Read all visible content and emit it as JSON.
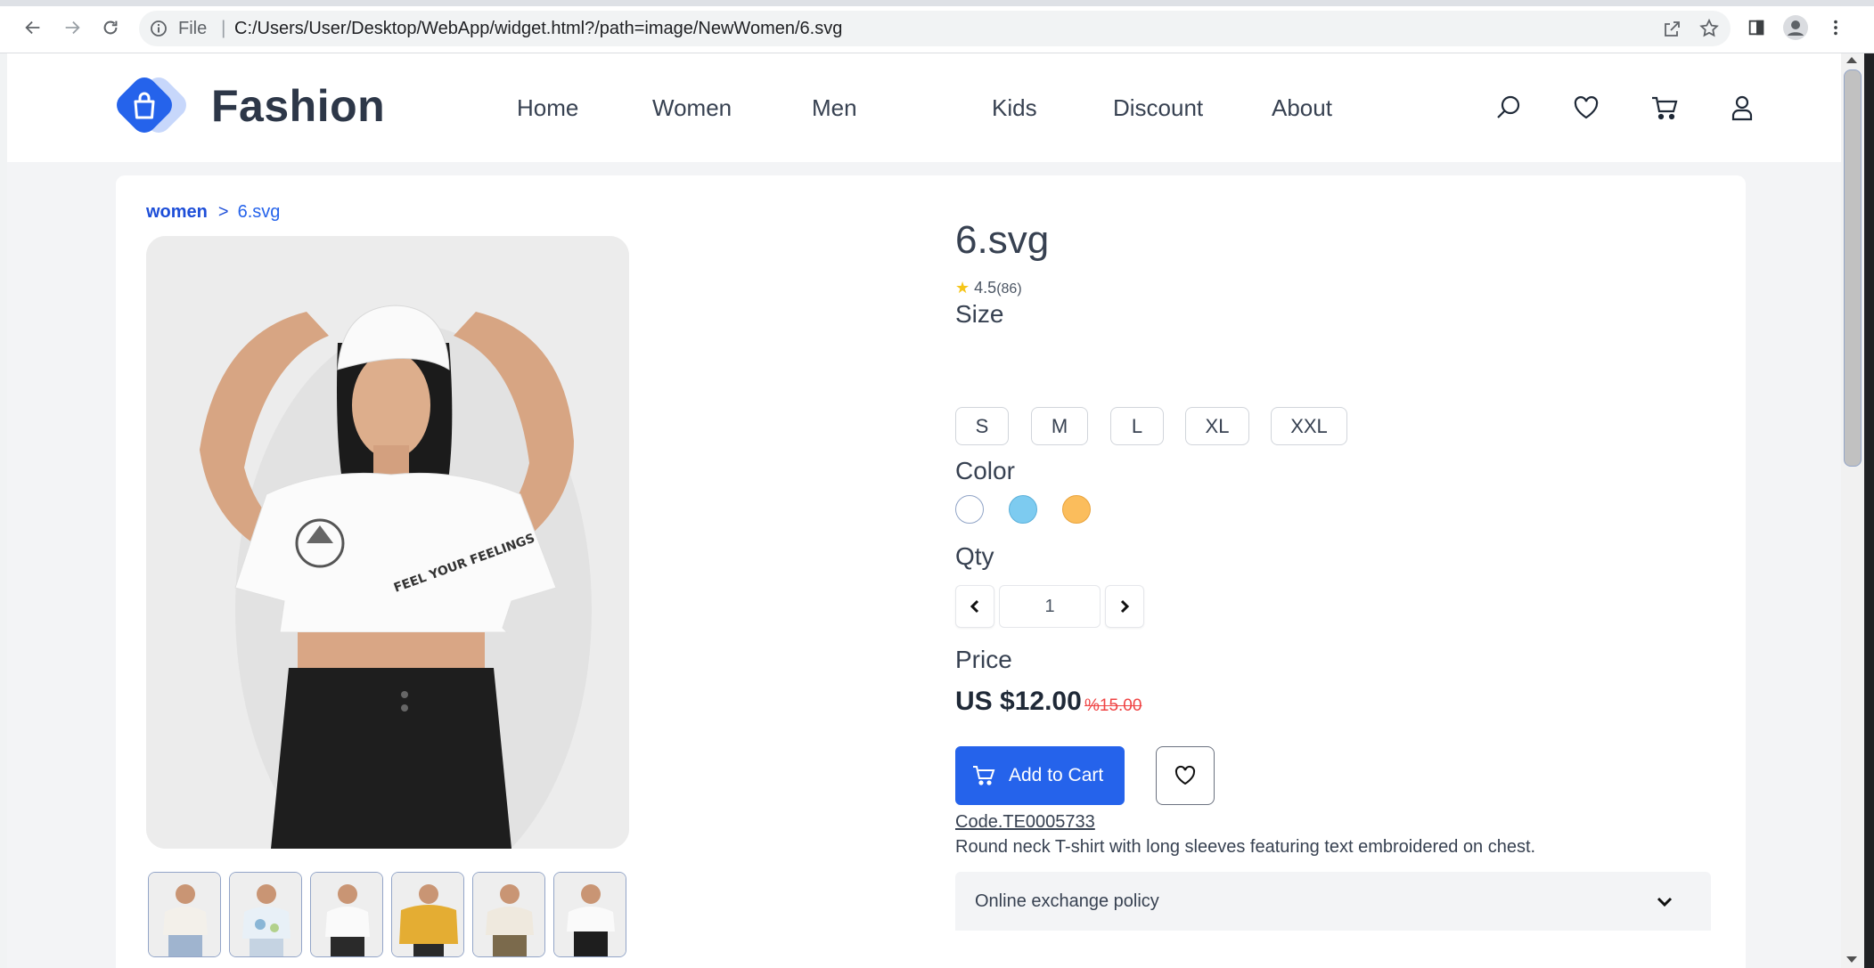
{
  "browser": {
    "file_label": "File",
    "separator": "|",
    "url": "C:/Users/User/Desktop/WebApp/widget.html?/path=image/NewWomen/6.svg"
  },
  "site": {
    "brand": "Fashion",
    "brand_color": "#2563eb",
    "nav": [
      "Home",
      "Women",
      "Men",
      "Kids",
      "Discount",
      "About"
    ],
    "header_icons": [
      "search-icon",
      "heart-icon",
      "cart-icon",
      "user-icon"
    ]
  },
  "breadcrumb": {
    "root": "women",
    "separator": ">",
    "current": "6.svg"
  },
  "product": {
    "title": "6.svg",
    "rating": "4.5",
    "rating_count": "(86)",
    "size_label": "Size",
    "sizes": [
      "S",
      "M",
      "L",
      "XL",
      "XXL"
    ],
    "color_label": "Color",
    "colors": [
      "#ffffff",
      "#7dcbf0",
      "#fbbd5c"
    ],
    "qty_label": "Qty",
    "qty_value": "1",
    "price_label": "Price",
    "price": "US $12.00",
    "old_price": "%15.00",
    "add_to_cart": "Add to Cart",
    "code": "Code.TE0005733",
    "description": "Round neck T-shirt with long sleeves featuring text embroidered on chest.",
    "policy": "Online exchange policy"
  },
  "thumbnails": [
    "thumbnail-1",
    "thumbnail-2",
    "thumbnail-3",
    "thumbnail-4",
    "thumbnail-5",
    "thumbnail-6"
  ]
}
